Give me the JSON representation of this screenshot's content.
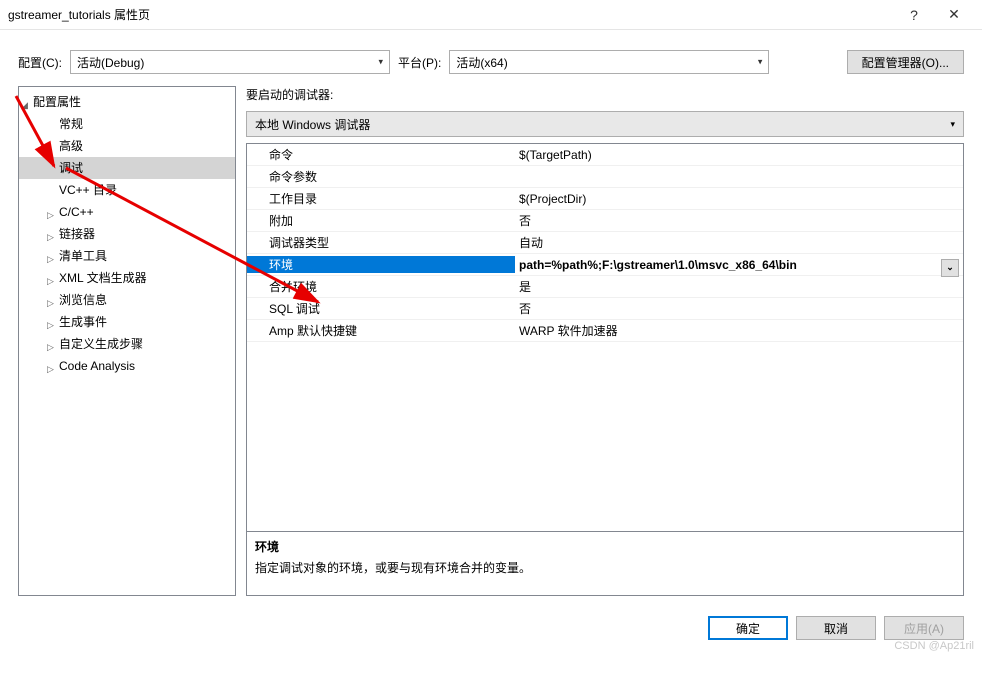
{
  "window": {
    "title": "gstreamer_tutorials 属性页",
    "help": "?",
    "close": "✕"
  },
  "toolbar": {
    "config_label": "配置(C):",
    "config_value": "活动(Debug)",
    "platform_label": "平台(P):",
    "platform_value": "活动(x64)",
    "manager_btn": "配置管理器(O)..."
  },
  "tree": {
    "root": "配置属性",
    "items": [
      {
        "label": "常规",
        "exp": false
      },
      {
        "label": "高级",
        "exp": false
      },
      {
        "label": "调试",
        "exp": false,
        "selected": true
      },
      {
        "label": "VC++ 目录",
        "exp": false
      },
      {
        "label": "C/C++",
        "exp": true
      },
      {
        "label": "链接器",
        "exp": true
      },
      {
        "label": "清单工具",
        "exp": true
      },
      {
        "label": "XML 文档生成器",
        "exp": true
      },
      {
        "label": "浏览信息",
        "exp": true
      },
      {
        "label": "生成事件",
        "exp": true
      },
      {
        "label": "自定义生成步骤",
        "exp": true
      },
      {
        "label": "Code Analysis",
        "exp": true
      }
    ]
  },
  "right": {
    "debugger_label": "要启动的调试器:",
    "debugger_value": "本地 Windows 调试器",
    "props": [
      {
        "key": "命令",
        "val": "$(TargetPath)"
      },
      {
        "key": "命令参数",
        "val": ""
      },
      {
        "key": "工作目录",
        "val": "$(ProjectDir)"
      },
      {
        "key": "附加",
        "val": "否"
      },
      {
        "key": "调试器类型",
        "val": "自动"
      },
      {
        "key": "环境",
        "val": "path=%path%;F:\\gstreamer\\1.0\\msvc_x86_64\\bin",
        "selected": true
      },
      {
        "key": "合并环境",
        "val": "是"
      },
      {
        "key": "SQL 调试",
        "val": "否"
      },
      {
        "key": "Amp 默认快捷键",
        "val": "WARP 软件加速器"
      }
    ],
    "desc_title": "环境",
    "desc_text": "指定调试对象的环境，或要与现有环境合并的变量。"
  },
  "footer": {
    "ok": "确定",
    "cancel": "取消",
    "apply": "应用(A)"
  },
  "watermark": "CSDN @Ap21ril"
}
